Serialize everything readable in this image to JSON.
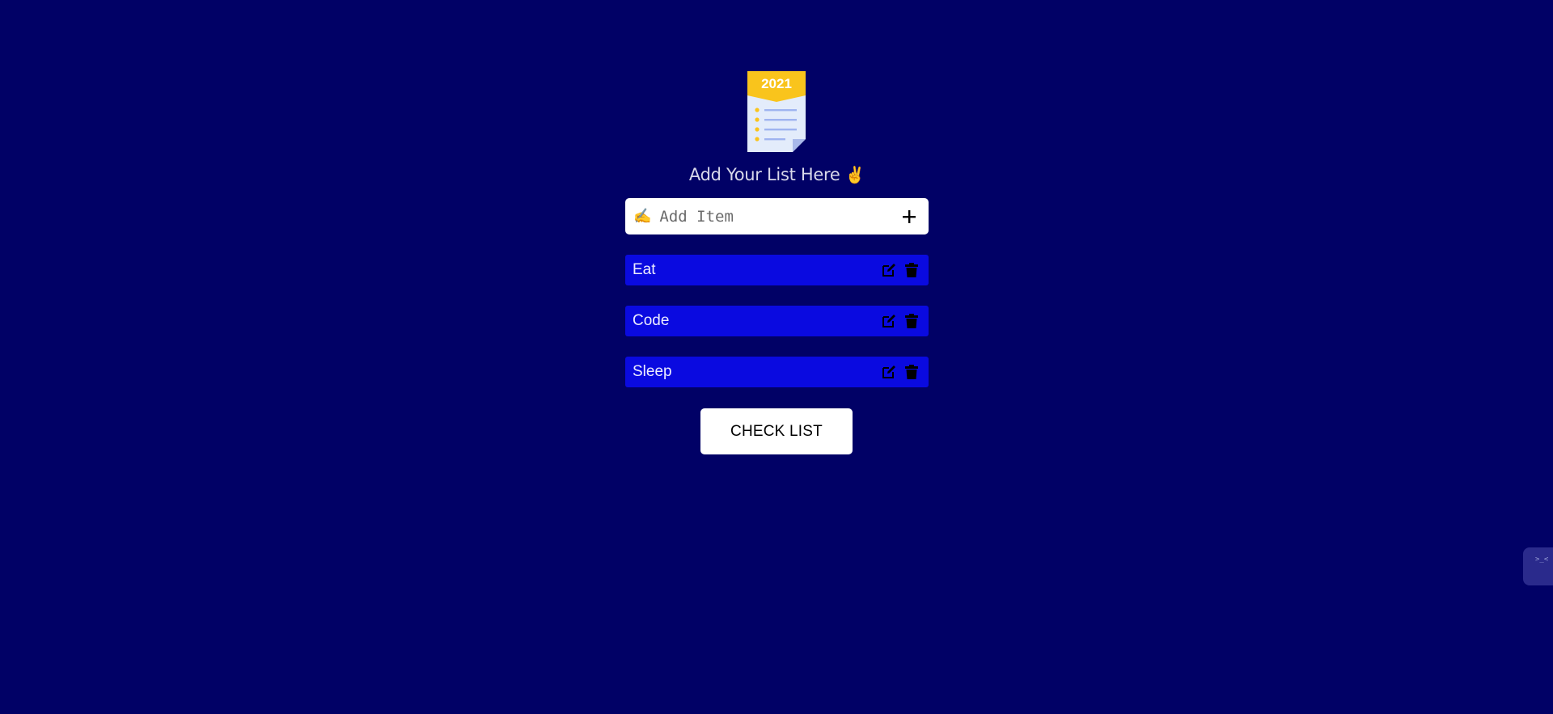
{
  "logo": {
    "year": "2021"
  },
  "heading": {
    "text": "Add Your List Here",
    "emoji": "✌️"
  },
  "input": {
    "icon": "✍️",
    "placeholder": "Add Item",
    "add_icon": "plus-icon"
  },
  "items": [
    {
      "label": "Eat"
    },
    {
      "label": "Code"
    },
    {
      "label": "Sleep"
    }
  ],
  "check_button": {
    "label": "CHECK LIST"
  },
  "side_widget": {
    "text": ">_<"
  },
  "colors": {
    "background": "#010166",
    "item": "#0a0ae0",
    "logo_accent": "#f9c41c"
  }
}
